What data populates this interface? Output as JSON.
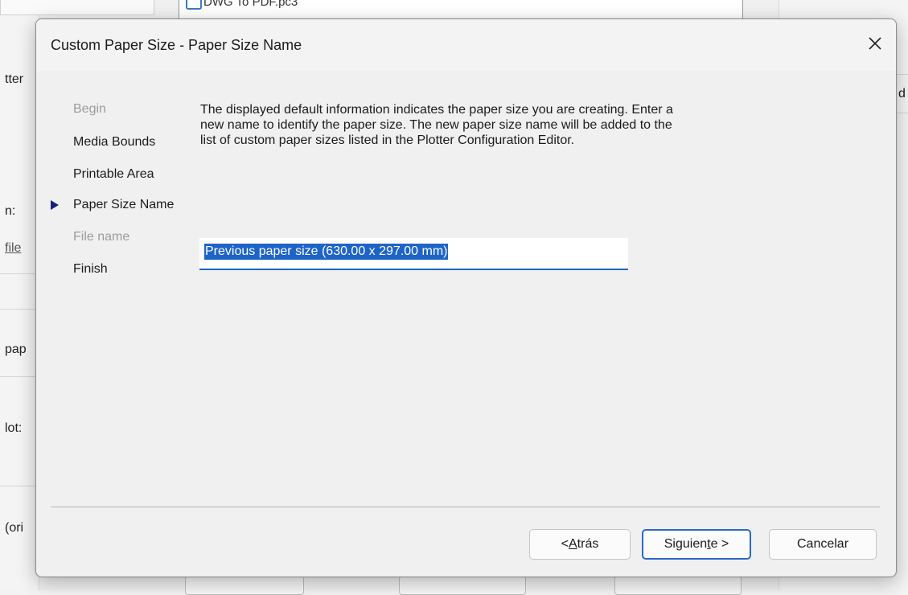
{
  "background": {
    "combo_text": "DWG To PDF.pc3",
    "left_labels": [
      "tter",
      "n:",
      "file",
      "pap",
      "lot:",
      "(ori"
    ],
    "right_label": "d"
  },
  "dialog": {
    "title": "Custom Paper Size - Paper Size Name",
    "close_icon": "close-icon",
    "steps": [
      {
        "label": "Begin",
        "state": "muted"
      },
      {
        "label": "Media Bounds",
        "state": "done"
      },
      {
        "label": "Printable Area",
        "state": "done"
      },
      {
        "label": "Paper Size Name",
        "state": "current"
      },
      {
        "label": "File name",
        "state": "muted"
      },
      {
        "label": "Finish",
        "state": "done"
      }
    ],
    "description": "The displayed default information indicates the paper size you are creating. Enter a new name to identify the paper size. The new paper size name will be added to the list of custom paper sizes listed in the Plotter Configuration Editor.",
    "name_field_value": "Previous paper size  (630.00 x 297.00 mm)",
    "buttons": {
      "back_pre": "< ",
      "back_accel": "A",
      "back_post": "trás",
      "next_pre": "Siguien",
      "next_accel": "t",
      "next_post": "e >",
      "cancel": "Cancelar"
    }
  }
}
